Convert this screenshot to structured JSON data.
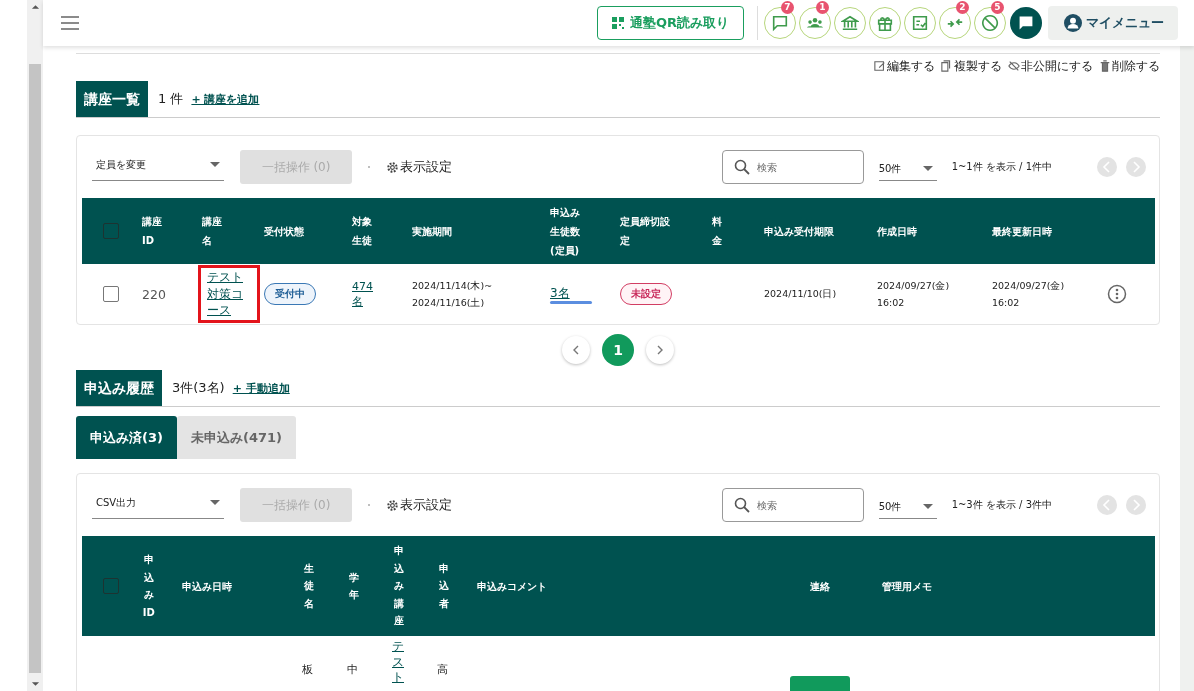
{
  "header": {
    "qr_button": "通塾QR読み取り",
    "icon_buttons": [
      {
        "kind": "chat",
        "badge": "7"
      },
      {
        "kind": "group",
        "badge": "1"
      },
      {
        "kind": "bank"
      },
      {
        "kind": "gift"
      },
      {
        "kind": "checklist"
      },
      {
        "kind": "merge",
        "badge": "2"
      },
      {
        "kind": "blocked",
        "badge": "5"
      }
    ],
    "my_menu": "マイメニュー"
  },
  "actions": [
    {
      "kind": "edit",
      "label": "編集する"
    },
    {
      "kind": "copy",
      "label": "複製する"
    },
    {
      "kind": "hide",
      "label": "非公開にする"
    },
    {
      "kind": "delete",
      "label": "削除する"
    }
  ],
  "courses": {
    "title": "講座一覧",
    "count": "1 件",
    "add_link": "+ 講座を追加",
    "toolbar": {
      "select": "定員を変更",
      "bulk_button": "一括操作 (0)",
      "bulk_disabled": true,
      "settings": "表示設定",
      "search_placeholder": "検索",
      "per_page": "50件",
      "range": "1~1件 を表示 / 1件中",
      "nav_disabled": true
    },
    "table": {
      "header_checked": false,
      "columns": [
        "講座ID",
        "講座名",
        "受付状態",
        "対象生徒",
        "実施期間",
        "申込み生徒数(定員)",
        "定員締切設定",
        "料金",
        "申込み受付期限",
        "作成日時",
        "最終更新日時"
      ],
      "rows": [
        {
          "checked": false,
          "id": "220",
          "name": "テスト対策コース",
          "highlighted": true,
          "status": {
            "kind": "open",
            "label": "受付中"
          },
          "target": "474名",
          "period": [
            "2024/11/14(木)~",
            "2024/11/16(土)"
          ],
          "applicants": "3名",
          "deadline_setting": {
            "kind": "unset",
            "label": "未設定"
          },
          "deadline": "2024/11/10(日)",
          "created": [
            "2024/09/27(金)",
            "16:02"
          ],
          "updated": [
            "2024/09/27(金)",
            "16:02"
          ]
        }
      ]
    },
    "pagination": [
      {
        "label": "1",
        "selected": true
      }
    ]
  },
  "applications": {
    "title": "申込み履歴",
    "count": "3件(3名)",
    "add_link": "+ 手動追加",
    "tabs": [
      {
        "label": "申込み済(3)",
        "selected": true
      },
      {
        "label": "未申込み(471)",
        "selected": false
      }
    ],
    "toolbar": {
      "select": "CSV出力",
      "bulk_button": "一括操作 (0)",
      "bulk_disabled": true,
      "settings": "表示設定",
      "search_placeholder": "検索",
      "per_page": "50件",
      "range": "1~3件 を表示 / 3件中",
      "nav_disabled": true
    },
    "table": {
      "header_checked": false,
      "columns": [
        {
          "label": "申込みID",
          "vertical": true
        },
        {
          "label": "申込み日時",
          "vertical": false
        },
        {
          "label": "生徒名",
          "vertical": true
        },
        {
          "label": "学年",
          "vertical": true
        },
        {
          "label": "申込み講座",
          "vertical": true
        },
        {
          "label": "申込者",
          "vertical": true
        },
        {
          "label": "申込みコメント",
          "vertical": false
        },
        {
          "label": "連絡",
          "vertical": false
        },
        {
          "label": "管理用メモ",
          "vertical": false
        }
      ],
      "rows": [
        {
          "student": "板",
          "grade": "中",
          "course": "テスト",
          "applicant": "高",
          "contact": {
            "kind": "button"
          }
        }
      ]
    }
  }
}
